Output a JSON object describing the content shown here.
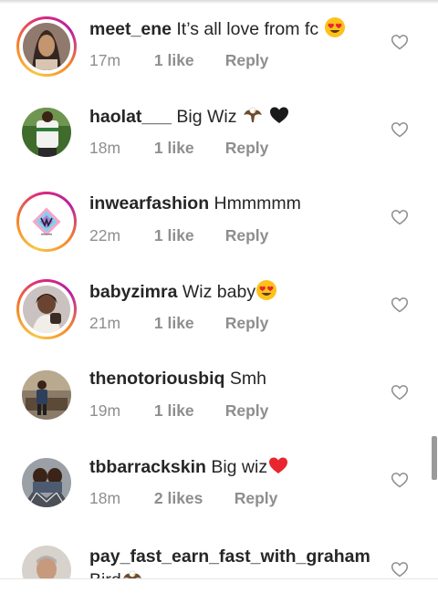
{
  "comments": [
    {
      "username": "meet_ene",
      "text": "It’s all love from fc",
      "time": "17m",
      "likes": "1 like",
      "reply": "Reply",
      "emoji": "heart-eyes-emoji",
      "ring": true
    },
    {
      "username": "haolat___",
      "text": "Big Wiz",
      "time": "18m",
      "likes": "1 like",
      "reply": "Reply",
      "emoji": "eagle-emoji black-heart-emoji",
      "ring": false
    },
    {
      "username": "inwearfashion",
      "text": "Hmmmmm",
      "time": "22m",
      "likes": "1 like",
      "reply": "Reply",
      "emoji": "",
      "ring": true
    },
    {
      "username": "babyzimra",
      "text": "Wiz baby",
      "time": "21m",
      "likes": "1 like",
      "reply": "Reply",
      "emoji": "heart-eyes-emoji",
      "ring": true
    },
    {
      "username": "thenotoriousbiq",
      "text": "Smh",
      "time": "19m",
      "likes": "1 like",
      "reply": "Reply",
      "emoji": "",
      "ring": false
    },
    {
      "username": "tbbarrackskin",
      "text": "Big wiz",
      "time": "18m",
      "likes": "2 likes",
      "reply": "Reply",
      "emoji": "red-heart-emoji",
      "ring": false
    },
    {
      "username": "pay_fast_earn_fast_with_graham",
      "text": "Bird",
      "time": "",
      "likes": "",
      "reply": "",
      "emoji": "eagle-emoji",
      "ring": false
    }
  ],
  "icons": {
    "like": "heart-outline-icon"
  },
  "colors": {
    "text": "#262626",
    "meta": "#8e8e8e",
    "heart_red": "#e8262e",
    "ring_orange": "#f58529",
    "ring_pink": "#dd2a7b"
  }
}
